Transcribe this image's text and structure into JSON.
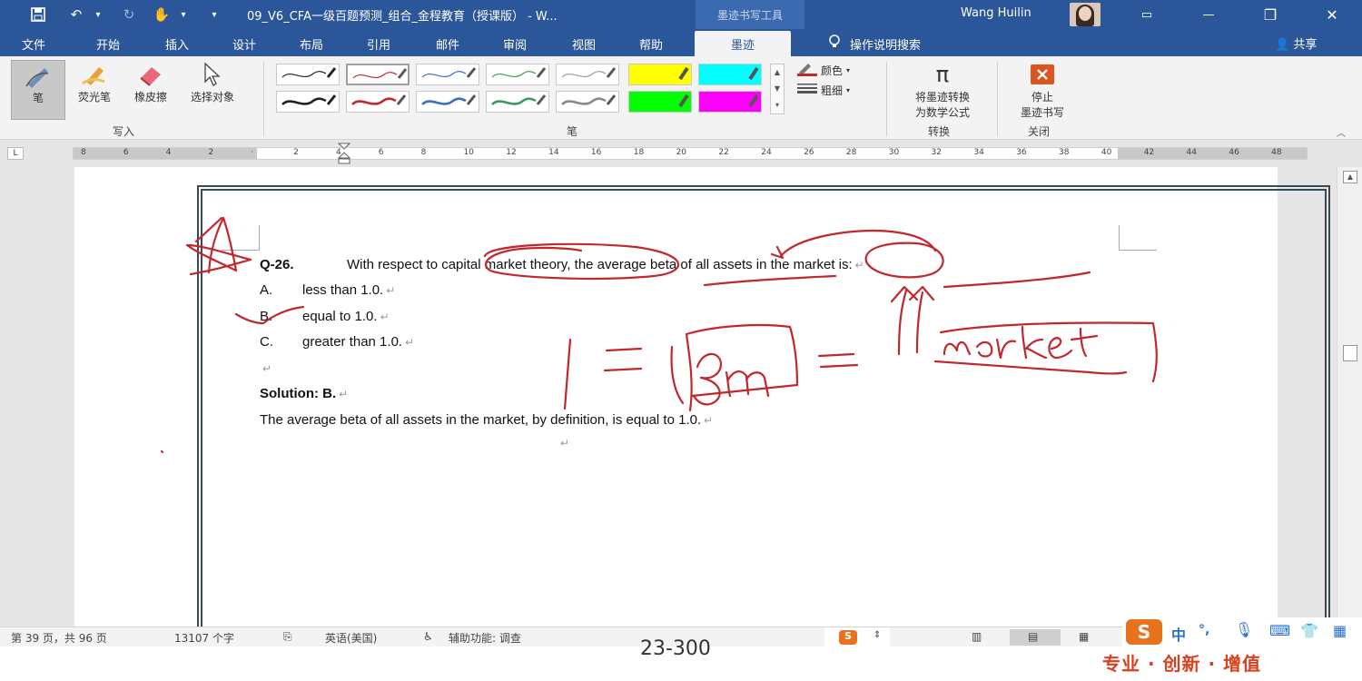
{
  "titlebar": {
    "save_icon": "save-icon",
    "undo_icon": "undo-icon",
    "redo_icon": "redo-icon",
    "touch_icon": "touch-mode-icon",
    "document_title": "09_V6_CFA一级百题预测_组合_金程教育（授课版） - W...",
    "context_tab": "墨迹书写工具",
    "user_name": "Wang Huilin",
    "minimize": "—",
    "restore": "❐",
    "close": "✕",
    "ribbon_display": "▭"
  },
  "tabs": [
    "文件",
    "开始",
    "插入",
    "设计",
    "布局",
    "引用",
    "邮件",
    "审阅",
    "视图",
    "帮助",
    "墨迹"
  ],
  "tell_me": "操作说明搜索",
  "share": "共享",
  "ribbon": {
    "write_group": {
      "label": "写入",
      "tools": [
        "笔",
        "荧光笔",
        "橡皮擦",
        "选择对象"
      ]
    },
    "pens_group": {
      "label": "笔",
      "color": "颜色",
      "thickness": "粗细"
    },
    "convert_group": {
      "label": "转换",
      "button": "将墨迹转换为数学公式",
      "button_line1": "将墨迹转换",
      "button_line2": "为数学公式"
    },
    "close_group": {
      "label": "关闭",
      "button_line1": "停止",
      "button_line2": "墨迹书写"
    }
  },
  "ruler_numbers": [
    "8",
    "6",
    "4",
    "2",
    "",
    "2",
    "4",
    "6",
    "8",
    "10",
    "12",
    "14",
    "16",
    "18",
    "20",
    "22",
    "24",
    "26",
    "28",
    "30",
    "32",
    "34",
    "36",
    "38",
    "40",
    "42",
    "44",
    "46",
    "48"
  ],
  "question": {
    "number": "Q-26.",
    "text": "With respect to capital market theory, the average beta of all assets in the market is:",
    "options": [
      {
        "letter": "A.",
        "text": "less than 1.0."
      },
      {
        "letter": "B.",
        "text": "equal to 1.0."
      },
      {
        "letter": "C.",
        "text": "greater than 1.0."
      }
    ],
    "solution_label": "Solution: B.",
    "solution_text": "The average beta of all assets in the market, by definition, is equal to 1.0."
  },
  "statusbar": {
    "page": "第 39 页，共 96 页",
    "words": "13107 个字",
    "language": "英语(美国)",
    "accessibility": "辅助功能: 调查"
  },
  "ime": {
    "chinese": "中",
    "mark": "°,"
  },
  "footer": {
    "page_range": "23-300",
    "slogan": "专业 · 创新 · 增值"
  },
  "colors": {
    "accent": "#2b579a",
    "ink": "#c2272d"
  }
}
